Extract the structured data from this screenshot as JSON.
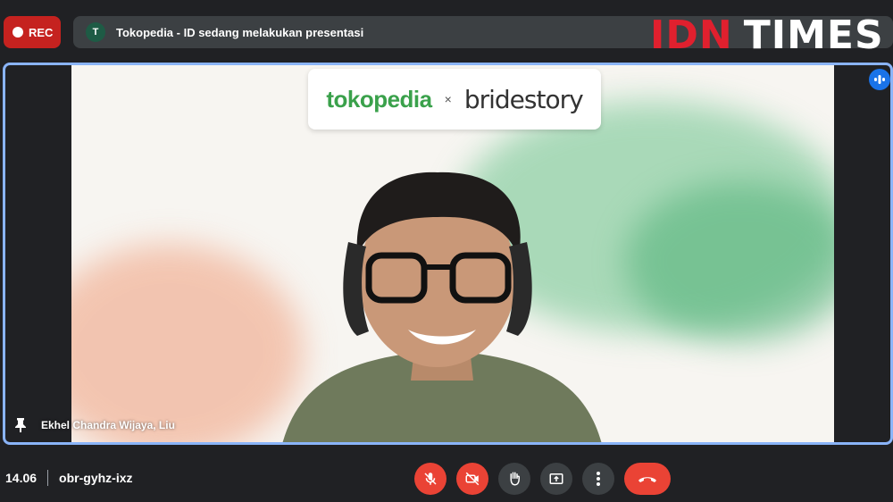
{
  "recording": {
    "label": "REC"
  },
  "presentation": {
    "avatar_letter": "T",
    "text": "Tokopedia - ID sedang melakukan presentasi"
  },
  "watermark": {
    "part1": "IDN",
    "part2": "TIMES"
  },
  "video": {
    "logo_left": "tokopedia",
    "logo_sep": "×",
    "logo_right": "bridestory",
    "participant_name": "Ekhel Chandra Wijaya, Liu"
  },
  "footer": {
    "time": "14.06",
    "meeting_code": "obr-gyhz-ixz"
  },
  "controls": [
    {
      "name": "mic-off-button",
      "icon": "mic-off-icon"
    },
    {
      "name": "camera-off-button",
      "icon": "camera-off-icon"
    },
    {
      "name": "raise-hand-button",
      "icon": "hand-icon"
    },
    {
      "name": "present-now-button",
      "icon": "present-icon"
    },
    {
      "name": "more-options-button",
      "icon": "more-vert-icon"
    },
    {
      "name": "leave-call-button",
      "icon": "phone-hangup-icon"
    }
  ],
  "colors": {
    "accent": "#8ab4f8",
    "danger": "#ea4335",
    "rec": "#c5221f",
    "idn_red": "#e0202e",
    "tokopedia_green": "#3aa14b"
  }
}
